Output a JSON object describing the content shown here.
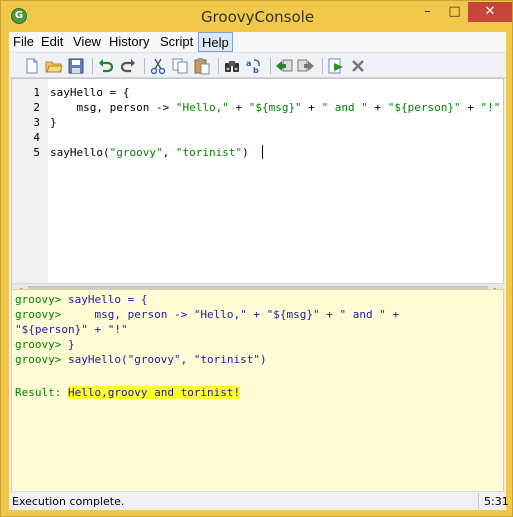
{
  "window": {
    "title": "GroovyConsole",
    "app_icon": "G",
    "controls": {
      "minimize": "–",
      "maximize": "□",
      "close": "✕"
    }
  },
  "menubar": {
    "items": [
      "File",
      "Edit",
      "View",
      "History",
      "Script",
      "Help"
    ]
  },
  "toolbar": {
    "icons": [
      "new-file-icon",
      "open-folder-icon",
      "save-icon",
      "undo-icon",
      "redo-icon",
      "cut-icon",
      "copy-icon",
      "paste-icon",
      "find-icon",
      "replace-icon",
      "previous-history-icon",
      "next-history-icon",
      "run-script-icon",
      "interrupt-icon"
    ]
  },
  "editor": {
    "line_numbers": [
      "1",
      "2",
      "3",
      "4",
      "5"
    ],
    "lines": [
      "sayHello = {",
      "    msg, person -> \"Hello,\" + \"${msg}\" + \" and \" + \"${person}\" + \"!\"",
      "}",
      "",
      "sayHello(\"groovy\", \"torinist\")"
    ]
  },
  "output": {
    "lines": [
      {
        "prompt": "groovy> ",
        "text": "sayHello = {"
      },
      {
        "prompt": "groovy> ",
        "text": "    msg, person -> \"Hello,\" + \"${msg}\" + \" and \" +"
      },
      {
        "prompt": "",
        "text": "\"${person}\" + \"!\""
      },
      {
        "prompt": "groovy> ",
        "text": "}"
      },
      {
        "prompt": "groovy> ",
        "text": "sayHello(\"groovy\", \"torinist\")"
      }
    ],
    "result_label": "Result: ",
    "result_value": "Hello,groovy and torinist!"
  },
  "statusbar": {
    "message": "Execution complete.",
    "position": "5:31"
  },
  "colors": {
    "title_bar": "#f2c84b",
    "close_button": "#c7463b",
    "output_background": "#fffcd5",
    "result_highlight": "#ffff2a",
    "prompt": "#008000",
    "output_text": "#1a1aa8"
  }
}
